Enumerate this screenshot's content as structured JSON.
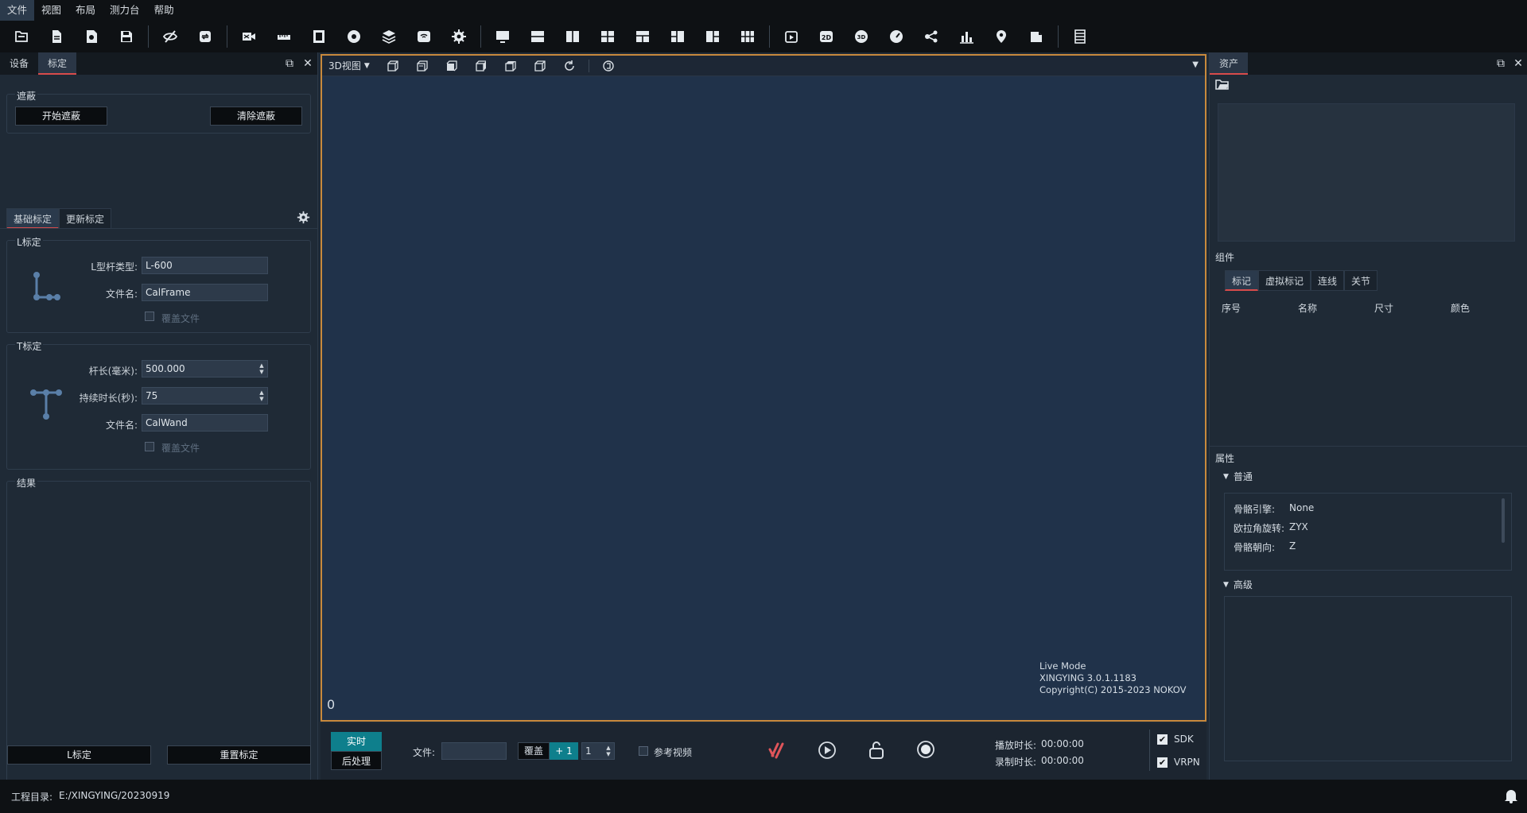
{
  "menu": [
    "文件",
    "视图",
    "布局",
    "测力台",
    "帮助"
  ],
  "left_dock": {
    "tabs": [
      "设备",
      "标定"
    ],
    "mask": {
      "title": "遮蔽",
      "start_label": "开始遮蔽",
      "clear_label": "清除遮蔽"
    },
    "subtabs": [
      "基础标定",
      "更新标定"
    ],
    "l_calib": {
      "title": "L标定",
      "type_label": "L型杆类型:",
      "type_value": "L-600",
      "file_label": "文件名:",
      "file_value": "CalFrame",
      "overwrite_label": "覆盖文件"
    },
    "t_calib": {
      "title": "T标定",
      "length_label": "杆长(毫米):",
      "length_value": "500.000",
      "duration_label": "持续时长(秒):",
      "duration_value": "75",
      "file_label": "文件名:",
      "file_value": "CalWand",
      "overwrite_label": "覆盖文件"
    },
    "result_title": "结果",
    "l_calib_button": "L标定",
    "reset_button": "重置标定"
  },
  "viewport": {
    "view_menu": "3D视图",
    "frame_counter": "0",
    "info": [
      "Live Mode",
      "XINGYING 3.0.1.1183",
      "Copyright(C) 2015-2023 NOKOV"
    ]
  },
  "transport": {
    "realtime": "实时",
    "postprocess": "后处理",
    "file_label": "文件:",
    "file_value": "",
    "overlay_label": "覆盖",
    "plus_one": "+ 1",
    "overlay_count": "1",
    "ref_video_label": "参考视频",
    "play_time_label": "播放时长:",
    "play_time": "00:00:00",
    "record_time_label": "录制时长:",
    "record_time": "00:00:00",
    "sdk_label": "SDK",
    "vrpn_label": "VRPN"
  },
  "right_dock": {
    "tab": "资产",
    "components_title": "组件",
    "component_tabs": [
      "标记",
      "虚拟标记",
      "连线",
      "关节"
    ],
    "columns": [
      "序号",
      "名称",
      "尺寸",
      "颜色"
    ],
    "properties_title": "属性",
    "general_title": "普通",
    "props": [
      {
        "key": "骨骼引擎:",
        "value": "None"
      },
      {
        "key": "欧拉角旋转:",
        "value": "ZYX"
      },
      {
        "key": "骨骼朝向:",
        "value": "Z"
      }
    ],
    "advanced_title": "高级"
  },
  "status": {
    "project_label": "工程目录:",
    "project_path": "E:/XINGYING/20230919"
  },
  "colors": {
    "accent_tab": "#d84b4b",
    "viewport_border": "#c8893c",
    "realtime_bg": "#0e7f8c",
    "logo_red": "#e0555a"
  }
}
